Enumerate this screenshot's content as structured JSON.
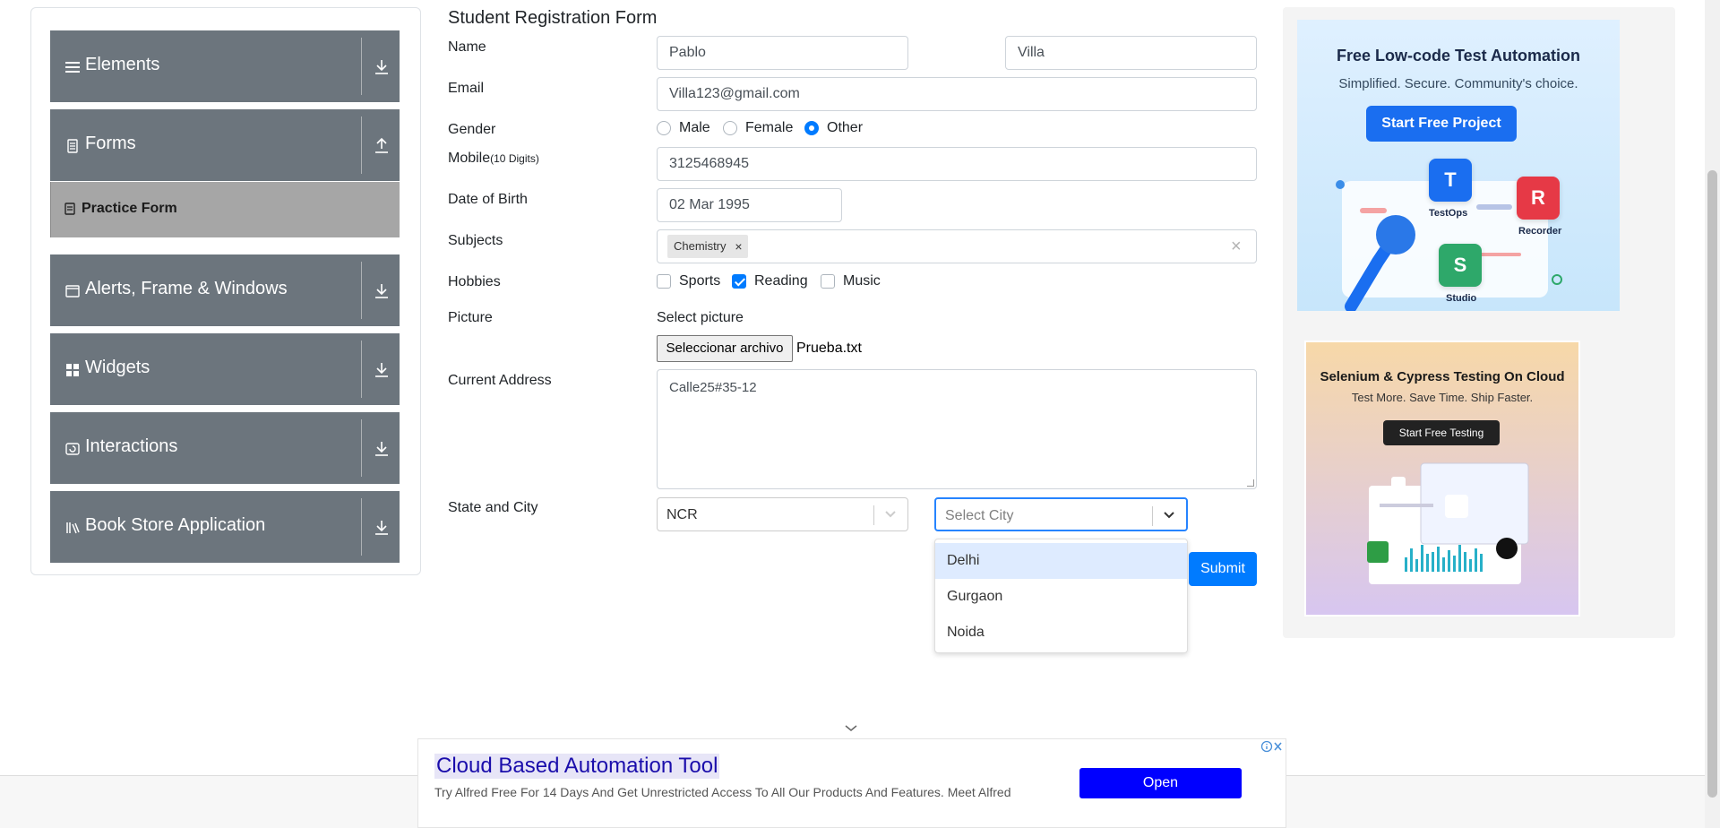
{
  "sidebar": {
    "groups": [
      {
        "title": "Elements",
        "icon": "hamburger-icon",
        "arrow": "download"
      },
      {
        "title": "Forms",
        "icon": "document-icon",
        "arrow": "upload"
      },
      {
        "title": "Alerts, Frame & Windows",
        "icon": "window-icon",
        "arrow": "download"
      },
      {
        "title": "Widgets",
        "icon": "grid-icon",
        "arrow": "download"
      },
      {
        "title": "Interactions",
        "icon": "cursor-icon",
        "arrow": "download"
      },
      {
        "title": "Book Store Application",
        "icon": "books-icon",
        "arrow": "download"
      }
    ],
    "active_item": "Practice Form"
  },
  "form": {
    "title": "Student Registration Form",
    "labels": {
      "name": "Name",
      "email": "Email",
      "gender": "Gender",
      "mobile": "Mobile",
      "mobile_hint": "(10 Digits)",
      "dob": "Date of Birth",
      "subjects": "Subjects",
      "hobbies": "Hobbies",
      "picture": "Picture",
      "address": "Current Address",
      "state_city": "State and City"
    },
    "first_name": "Pablo",
    "last_name": "Villa",
    "email": "Villa123@gmail.com",
    "gender_options": [
      "Male",
      "Female",
      "Other"
    ],
    "gender_selected": "Other",
    "mobile": "3125468945",
    "dob": "02 Mar 1995",
    "subjects": [
      "Chemistry"
    ],
    "hobby_options": [
      "Sports",
      "Reading",
      "Music"
    ],
    "hobbies_checked": [
      "Reading"
    ],
    "picture_label": "Select picture",
    "file_button": "Seleccionar archivo",
    "file_name": "Prueba.txt",
    "address": "Calle25#35-12",
    "state": "NCR",
    "city_placeholder": "Select City",
    "city_options": [
      "Delhi",
      "Gurgaon",
      "Noida"
    ],
    "city_highlighted": "Delhi",
    "submit": "Submit"
  },
  "ads": {
    "ad1": {
      "title": "Free Low-code Test Automation",
      "subtitle": "Simplified. Secure. Community's choice.",
      "button": "Start Free Project",
      "tiles": [
        "TestOps",
        "Recorder",
        "Studio"
      ]
    },
    "ad2": {
      "title": "Selenium & Cypress Testing On Cloud",
      "subtitle": "Test More. Save Time. Ship Faster.",
      "button": "Start Free Testing"
    },
    "bottom": {
      "headline": "Cloud Based Automation Tool",
      "description": "Try Alfred Free For 14 Days And Get Unrestricted Access To All Our Products And Features. Meet Alfred",
      "button": "Open"
    }
  },
  "colors": {
    "sidebar_group": "#6c757d",
    "sidebar_active": "#a6a6a6",
    "primary": "#007bff",
    "focus_border": "#2684ff",
    "option_highlight": "#deebff",
    "bottom_ad_button": "#0000ff"
  }
}
